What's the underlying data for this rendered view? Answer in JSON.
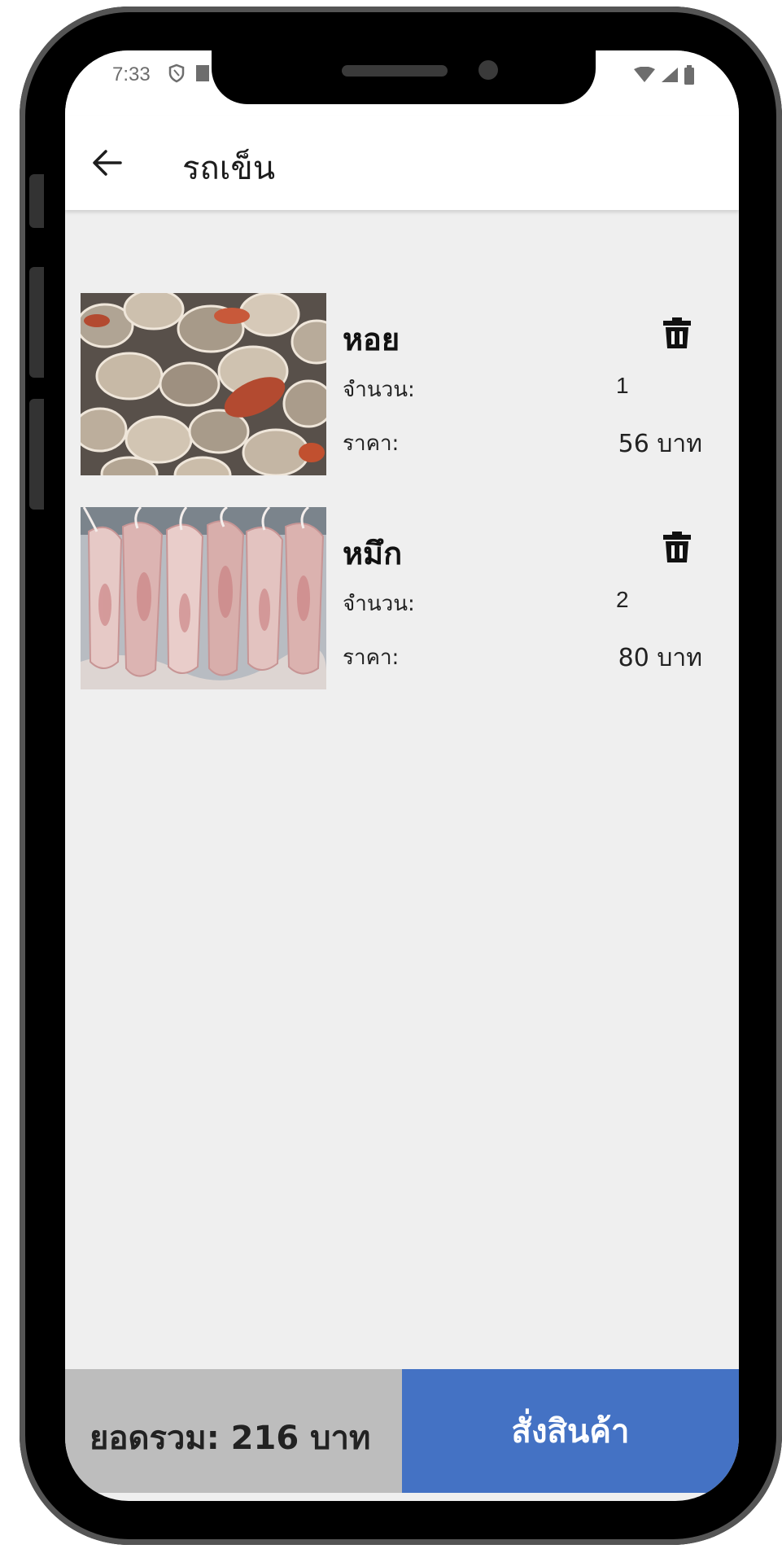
{
  "status_bar": {
    "time": "7:33",
    "left_icons": [
      "shield-icon",
      "notification-icon"
    ],
    "right_icons": [
      "wifi-icon",
      "signal-icon",
      "battery-icon"
    ]
  },
  "app_bar": {
    "title": "รถเข็น",
    "back_icon": "back-arrow-icon"
  },
  "cart": {
    "qty_label": "จำนวน:",
    "price_label": "ราคา:",
    "items": [
      {
        "name": "หอย",
        "quantity": "1",
        "price": "56 บาท",
        "image": "cockles-photo"
      },
      {
        "name": "หมึก",
        "quantity": "2",
        "price": "80 บาท",
        "image": "squid-photo"
      }
    ]
  },
  "footer": {
    "total": "ยอดรวม: 216 บาท",
    "order_label": "สั่งสินค้า"
  },
  "colors": {
    "accent": "#4472c4",
    "total_bg": "#bdbdbd",
    "screen_bg": "#efefef"
  }
}
